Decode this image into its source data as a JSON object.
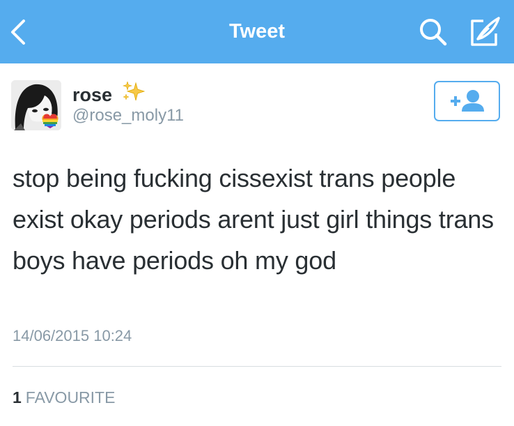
{
  "header": {
    "title": "Tweet",
    "back_icon": "chevron-left-icon",
    "search_icon": "search-icon",
    "compose_icon": "compose-tweet-icon",
    "background_color": "#55acee"
  },
  "tweet": {
    "user": {
      "display_name": "rose",
      "name_emoji": "sparkles",
      "handle": "@rose_moly11"
    },
    "follow_button_icon": "follow-user-icon",
    "text": "stop being fucking cissexist trans people exist okay periods arent just girl things trans boys have periods oh my god",
    "timestamp": "14/06/2015 10:24",
    "stats": {
      "favourites_count": "1",
      "favourites_label": "FAVOURITE"
    }
  },
  "colors": {
    "primary_text": "#292f33",
    "secondary_text": "#8899a6",
    "accent": "#55acee"
  }
}
